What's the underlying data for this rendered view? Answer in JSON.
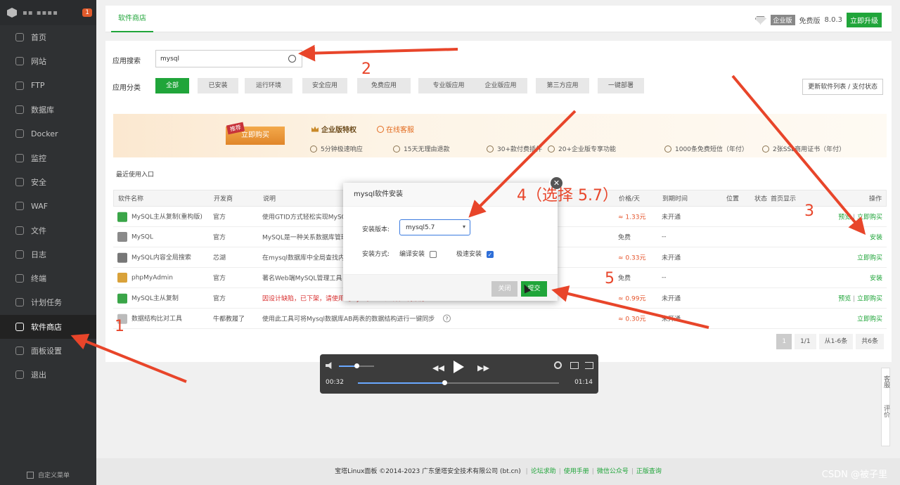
{
  "sidebar": {
    "host": "▪▪ ▪▪▪▪",
    "badge": "1",
    "items": [
      {
        "label": "首页",
        "icon": "home-icon"
      },
      {
        "label": "网站",
        "icon": "globe-icon"
      },
      {
        "label": "FTP",
        "icon": "ftp-icon"
      },
      {
        "label": "数据库",
        "icon": "database-icon"
      },
      {
        "label": "Docker",
        "icon": "docker-icon"
      },
      {
        "label": "监控",
        "icon": "monitor-icon"
      },
      {
        "label": "安全",
        "icon": "shield-icon"
      },
      {
        "label": "WAF",
        "icon": "waf-icon"
      },
      {
        "label": "文件",
        "icon": "folder-icon"
      },
      {
        "label": "日志",
        "icon": "log-icon"
      },
      {
        "label": "终端",
        "icon": "terminal-icon"
      },
      {
        "label": "计划任务",
        "icon": "clock-icon"
      },
      {
        "label": "软件商店",
        "icon": "grid-icon"
      },
      {
        "label": "面板设置",
        "icon": "settings-icon"
      },
      {
        "label": "退出",
        "icon": "logout-icon"
      }
    ],
    "active_index": 12,
    "custom_menu": "自定义菜单"
  },
  "topbar": {
    "tab": "软件商店",
    "edition_badge": "企业版",
    "free_edition": "免费版",
    "version": "8.0.3",
    "upgrade": "立即升级"
  },
  "search": {
    "label": "应用搜索",
    "value": "mysql"
  },
  "categories": {
    "label": "应用分类",
    "items": [
      "全部",
      "已安装",
      "运行环境",
      "安全应用",
      "免费应用",
      "专业版应用",
      "企业版应用",
      "第三方应用",
      "一键部署"
    ],
    "active_index": 0,
    "refresh": "更新软件列表 / 支付状态"
  },
  "banner": {
    "tag": "推荐",
    "buy": "立即购买",
    "title": "企业版特权",
    "service": "在线客服",
    "features": [
      "5分钟极速响应",
      "15天无理由退款",
      "30+款付费插件",
      "20+企业版专享功能",
      "1000条免费短信（年付）",
      "2张SSL商用证书（年付）"
    ]
  },
  "recent": "最近使用入口",
  "table": {
    "headers": [
      "软件名称",
      "开发商",
      "说明",
      "价格/天",
      "到期时间",
      "位置",
      "状态",
      "首页显示",
      "操作"
    ],
    "rows": [
      {
        "name": "MySQL主从复制(重构版)",
        "dev": "官方",
        "desc": "使用GTID方式轻松实现MySQ",
        "price": "≈ 1.33元",
        "expire": "未开通",
        "action1": "预览",
        "action2": "立即购买",
        "icon_color": "#3aa548"
      },
      {
        "name": "MySQL",
        "dev": "官方",
        "desc": "MySQL是一种关系数据库管理",
        "price": "免费",
        "expire": "--",
        "action1": "",
        "action2": "安装",
        "icon_color": "#8a8a8a"
      },
      {
        "name": "MySQL内容全局搜索",
        "dev": "芯湖",
        "desc": "在mysql数据库中全局查找内",
        "price": "≈ 0.33元",
        "expire": "未开通",
        "action1": "",
        "action2": "立即购买",
        "icon_color": "#777777"
      },
      {
        "name": "phpMyAdmin",
        "dev": "官方",
        "desc": "著名Web端MySQL管理工具",
        "price": "免费",
        "expire": "--",
        "action1": "",
        "action2": "安装",
        "icon_color": "#d9a23a"
      },
      {
        "name": "MySQL主从复制",
        "dev": "官方",
        "desc": "因设计缺陷，已下架，请使用【MySQL主从复制(重构版)】",
        "price": "≈ 0.99元",
        "expire": "未开通",
        "action1": "预览",
        "action2": "立即购买",
        "icon_color": "#3aa548"
      },
      {
        "name": "数据结构比对工具",
        "dev": "牛都教履了",
        "desc": "使用此工具可将Mysql数据库AB两表的数据结构进行一键同步",
        "price": "≈ 0.30元",
        "expire": "未开通",
        "action1": "",
        "action2": "立即购买",
        "icon_color": "#bbbbbb"
      }
    ]
  },
  "pager": {
    "current": "1",
    "pages": "1/1",
    "range": "从1-6条",
    "total": "共6条"
  },
  "dialog": {
    "title": "mysql软件安装",
    "version_label": "安装版本:",
    "version_value": "mysql5.7",
    "method_label": "安装方式:",
    "compile": "编译安装",
    "fast": "极速安装",
    "compile_checked": false,
    "fast_checked": true,
    "close": "关闭",
    "submit": "提交"
  },
  "player": {
    "current": "00:32",
    "duration": "01:14",
    "progress": 0.43,
    "volume": 0.5
  },
  "footer": {
    "copyright": "宝塔Linux面板 ©2014-2023 广东堡塔安全技术有限公司 (bt.cn)",
    "links": [
      "论坛求助",
      "使用手册",
      "微信公众号",
      "正版查询"
    ]
  },
  "float": {
    "service": "客服",
    "review": "评价"
  },
  "watermark": "CSDN @被子里",
  "annotations": {
    "numbers": [
      "1",
      "2",
      "3",
      "4（选择 5.7）",
      "5"
    ],
    "color": "#e8452a"
  }
}
